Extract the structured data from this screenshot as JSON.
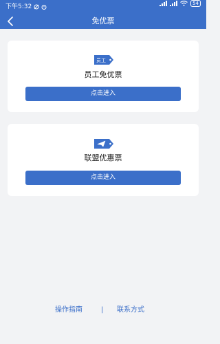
{
  "status_bar": {
    "time": "下午5:32",
    "battery": "54"
  },
  "nav": {
    "title": "免优票",
    "back_icon": "chevron-left-icon"
  },
  "cards": [
    {
      "tag_text": "员工",
      "title": "员工免优票",
      "button_label": "点击进入"
    },
    {
      "tag_icon": "paper-plane-icon",
      "title": "联盟优惠票",
      "button_label": "点击进入"
    }
  ],
  "footer": {
    "guide_label": "操作指南",
    "divider": "|",
    "contact_label": "联系方式"
  },
  "colors": {
    "primary": "#3b6fc9",
    "background": "#f2f3f5",
    "card": "#ffffff"
  }
}
